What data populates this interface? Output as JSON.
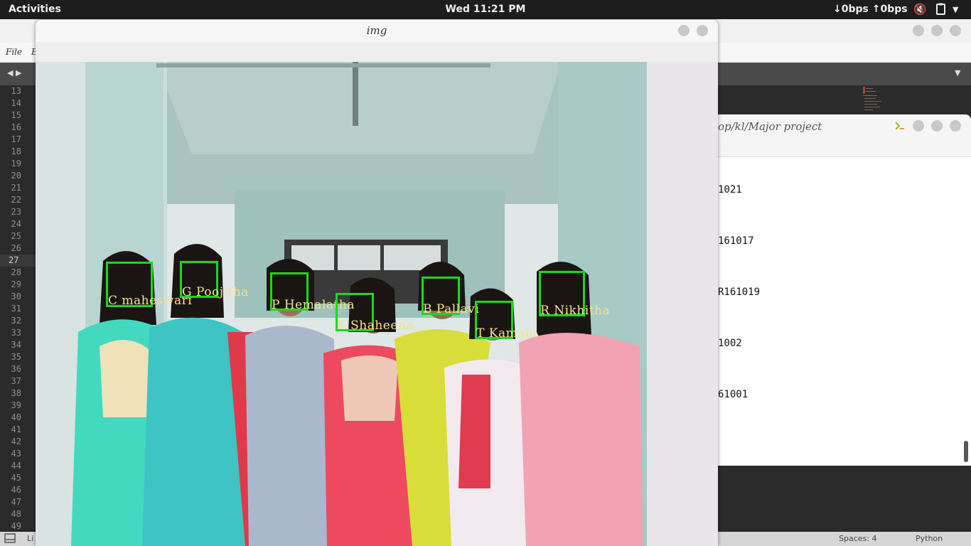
{
  "topbar": {
    "activities": "Activities",
    "clock": "Wed 11:21 PM",
    "netspeed": "↓0bps ↑0bps",
    "icons": [
      "speaker-muted-icon",
      "clipboard-icon",
      "system-menu-arrow-icon"
    ]
  },
  "editor": {
    "menu": [
      "File",
      "E"
    ],
    "line_numbers": [
      "13",
      "14",
      "15",
      "16",
      "17",
      "18",
      "19",
      "20",
      "21",
      "22",
      "23",
      "24",
      "25",
      "26",
      "27",
      "28",
      "29",
      "30",
      "31",
      "32",
      "33",
      "34",
      "35",
      "36",
      "37",
      "38",
      "39",
      "40",
      "41",
      "42",
      "43",
      "44",
      "45",
      "46",
      "47",
      "48",
      "49"
    ],
    "current_line": "27",
    "status": {
      "left": "Li",
      "spaces": "Spaces: 4",
      "language": "Python"
    }
  },
  "terminal": {
    "title": "op/kl/Major project",
    "lines": [
      "1021",
      "161017",
      "R161019",
      "1002",
      "61001"
    ]
  },
  "img_window": {
    "title": "img",
    "faces": [
      {
        "label": "C maheswari"
      },
      {
        "label": "G Poojitha"
      },
      {
        "label": "P Hemalatha"
      },
      {
        "label": "K Shaheena"
      },
      {
        "label": "B Pallavi"
      },
      {
        "label": "T Kamala"
      },
      {
        "label": "R Nikhitha"
      }
    ]
  },
  "colors": {
    "face_box": "#19d91c",
    "face_label": "#f5e38b",
    "topbar_bg": "#1d1d1d",
    "editor_bg": "#2b2b2b"
  }
}
